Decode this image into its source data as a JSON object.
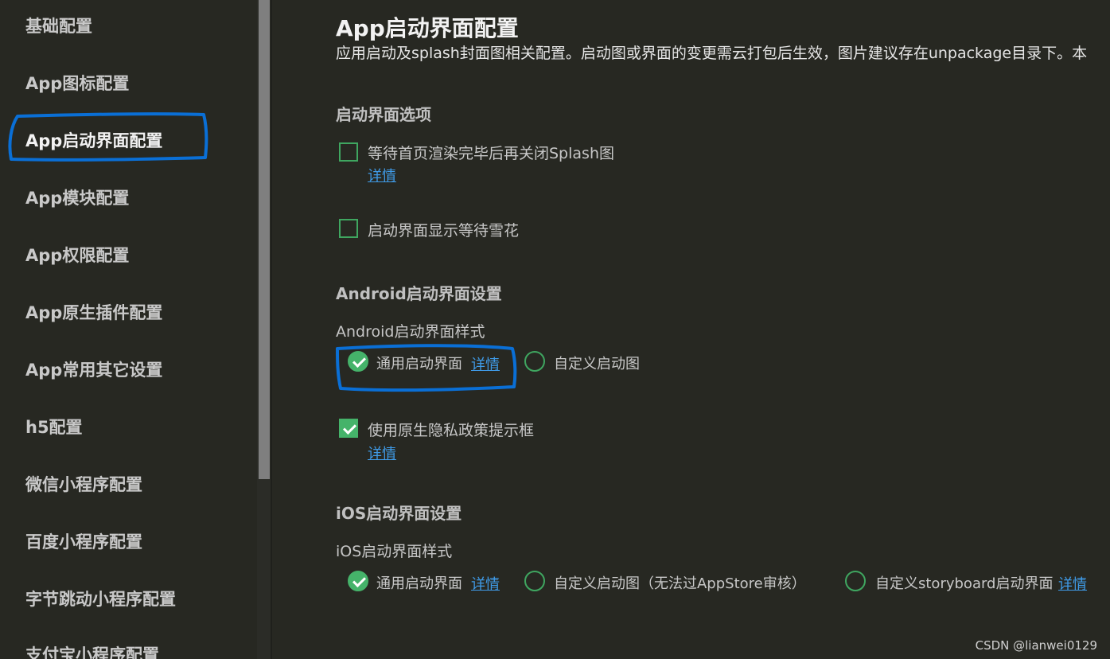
{
  "sidebar": {
    "items": [
      {
        "label": "基础配置"
      },
      {
        "label": "App图标配置"
      },
      {
        "label": "App启动界面配置"
      },
      {
        "label": "App模块配置"
      },
      {
        "label": "App权限配置"
      },
      {
        "label": "App原生插件配置"
      },
      {
        "label": "App常用其它设置"
      },
      {
        "label": "h5配置"
      },
      {
        "label": "微信小程序配置"
      },
      {
        "label": "百度小程序配置"
      },
      {
        "label": "字节跳动小程序配置"
      },
      {
        "label": "支付宝小程序配置"
      }
    ],
    "active_index": 2
  },
  "main": {
    "title": "App启动界面配置",
    "description": "应用启动及splash封面图相关配置。启动图或界面的变更需云打包后生效，图片建议存在unpackage目录下。本",
    "launch_options": {
      "title": "启动界面选项",
      "wait_render": {
        "label": "等待首页渲染完毕后再关闭Splash图",
        "link": "详情",
        "checked": false
      },
      "show_snow": {
        "label": "启动界面显示等待雪花",
        "checked": false
      }
    },
    "android": {
      "title": "Android启动界面设置",
      "style_label": "Android启动界面样式",
      "options": [
        {
          "label": "通用启动界面",
          "link": "详情",
          "checked": true
        },
        {
          "label": "自定义启动图",
          "checked": false
        }
      ],
      "privacy": {
        "label": "使用原生隐私政策提示框",
        "link": "详情",
        "checked": true
      }
    },
    "ios": {
      "title": "iOS启动界面设置",
      "style_label": "iOS启动界面样式",
      "options": [
        {
          "label": "通用启动界面",
          "link": "详情",
          "checked": true
        },
        {
          "label": "自定义启动图（无法过AppStore审核）",
          "checked": false
        },
        {
          "label": "自定义storyboard启动界面",
          "link": "详情",
          "checked": false
        }
      ]
    }
  },
  "watermark": "CSDN @lianwei0129",
  "colors": {
    "background": "#272822",
    "accent_green": "#45b36a",
    "link_blue": "#3f9be8",
    "annotation_blue": "#0a6fd6"
  }
}
